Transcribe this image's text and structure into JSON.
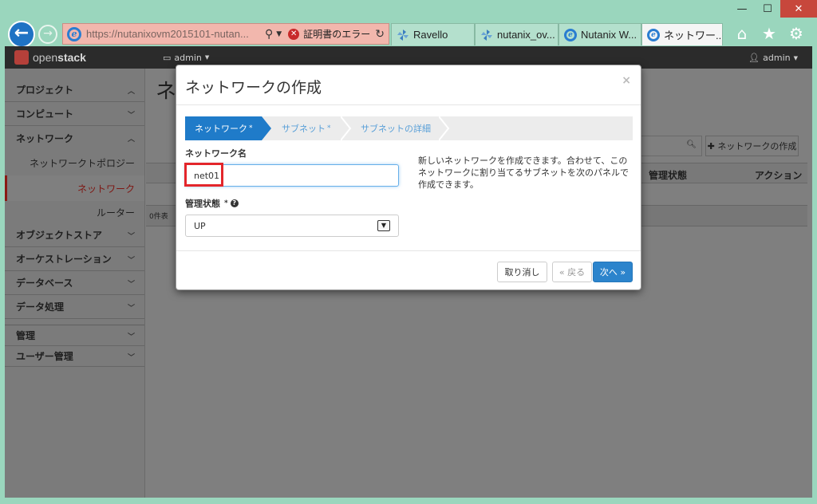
{
  "browser": {
    "url": "https://nutanixovm2015101-nutan...",
    "cert_error": "証明書のエラー",
    "tabs": [
      {
        "label": "Ravello",
        "icon": "pinwheel-icon",
        "active": false
      },
      {
        "label": "nutanix_ov...",
        "icon": "pinwheel-icon",
        "active": false
      },
      {
        "label": "Nutanix W...",
        "icon": "ie-page-icon",
        "active": false
      },
      {
        "label": "ネットワー...",
        "icon": "ie-page-icon",
        "active": true
      }
    ],
    "colors": {
      "frame": "#9ad6bd",
      "close_button": "#c7473c",
      "back_button": "#1f73c4"
    }
  },
  "header": {
    "brand_open": "open",
    "brand_stack": "stack",
    "project": "admin",
    "user": "admin"
  },
  "sidebar": {
    "project": "プロジェクト",
    "compute": "コンピュート",
    "network": "ネットワーク",
    "network_items": [
      "ネットワークトポロジー",
      "ネットワーク",
      "ルーター"
    ],
    "active_item": "ネットワーク",
    "object_store": "オブジェクトストア",
    "orchestration": "オーケストレーション",
    "database": "データベース",
    "data_processing": "データ処理",
    "admin": "管理",
    "identity": "ユーザー管理"
  },
  "page": {
    "title": "ネ",
    "create_button": "ネットワークの作成",
    "columns": {
      "admin_state": "管理状態",
      "actions": "アクション"
    },
    "footer": "0件表"
  },
  "modal": {
    "title": "ネットワークの作成",
    "close": "×",
    "steps": [
      {
        "label": "ネットワーク",
        "required": "*",
        "active": true
      },
      {
        "label": "サブネット",
        "required": "*",
        "active": false
      },
      {
        "label": "サブネットの詳細",
        "required": "",
        "active": false
      }
    ],
    "network_name_label": "ネットワーク名",
    "network_name_value": "net01",
    "admin_state_label": "管理状態",
    "admin_state_required": "*",
    "admin_state_value": "UP",
    "help_text": "新しいネットワークを作成できます。合わせて、このネットワークに割り当てるサブネットを次のパネルで作成できます。",
    "buttons": {
      "cancel": "取り消し",
      "back": "« 戻る",
      "next": "次へ »"
    },
    "colors": {
      "active_step": "#1f7bc9",
      "inactive_step_text": "#5aa0d8",
      "primary": "#2c84cc",
      "highlight": "#e3262b"
    }
  }
}
